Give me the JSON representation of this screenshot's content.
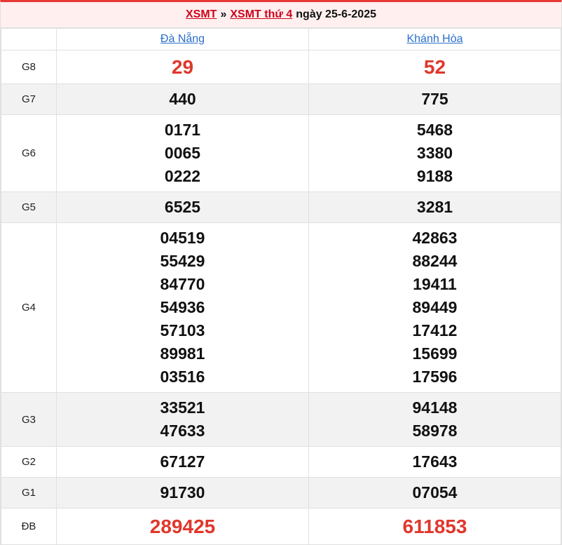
{
  "header": {
    "crumb_1": "XSMT",
    "separator": "»",
    "crumb_2": "XSMT thứ 4",
    "date_text": "ngày 25-6-2025"
  },
  "provinces": [
    "Đà Nẵng",
    "Khánh Hòa"
  ],
  "prizes": [
    {
      "label": "G8",
      "values": [
        [
          "29"
        ],
        [
          "52"
        ]
      ]
    },
    {
      "label": "G7",
      "values": [
        [
          "440"
        ],
        [
          "775"
        ]
      ]
    },
    {
      "label": "G6",
      "values": [
        [
          "0171",
          "0065",
          "0222"
        ],
        [
          "5468",
          "3380",
          "9188"
        ]
      ]
    },
    {
      "label": "G5",
      "values": [
        [
          "6525"
        ],
        [
          "3281"
        ]
      ]
    },
    {
      "label": "G4",
      "values": [
        [
          "04519",
          "55429",
          "84770",
          "54936",
          "57103",
          "89981",
          "03516"
        ],
        [
          "42863",
          "88244",
          "19411",
          "89449",
          "17412",
          "15699",
          "17596"
        ]
      ]
    },
    {
      "label": "G3",
      "values": [
        [
          "33521",
          "47633"
        ],
        [
          "94148",
          "58978"
        ]
      ]
    },
    {
      "label": "G2",
      "values": [
        [
          "67127"
        ],
        [
          "17643"
        ]
      ]
    },
    {
      "label": "G1",
      "values": [
        [
          "91730"
        ],
        [
          "07054"
        ]
      ]
    },
    {
      "label": "ĐB",
      "values": [
        [
          "289425"
        ],
        [
          "611853"
        ]
      ]
    }
  ],
  "colors": {
    "accent_red": "#e0372c",
    "link_red": "#d0021b",
    "link_blue": "#2a6fcc",
    "title_bg": "#fff0ef",
    "alt_row_bg": "#f2f2f2"
  }
}
